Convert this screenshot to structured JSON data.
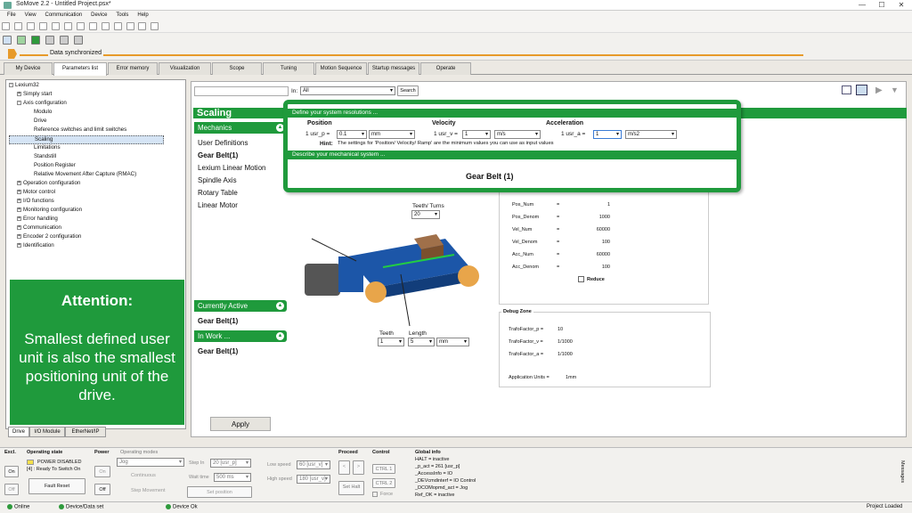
{
  "window": {
    "title": "SoMove 2.2 - Untitled Project.psx*",
    "min": "—",
    "max": "☐",
    "close": "✕"
  },
  "menu": [
    "File",
    "View",
    "Communication",
    "Device",
    "Tools",
    "Help"
  ],
  "sync": {
    "label": "Data synchronized"
  },
  "tabs": [
    "My Device",
    "Parameters list",
    "Error memory",
    "Visualization",
    "Scope",
    "Tuning",
    "Motion Sequence",
    "Startup messages",
    "Operate"
  ],
  "tree": [
    {
      "label": "Lexium32",
      "lvl": 0,
      "exp": "-"
    },
    {
      "label": "Simply start",
      "lvl": 1,
      "exp": "+"
    },
    {
      "label": "Axis configuration",
      "lvl": 1,
      "exp": "-"
    },
    {
      "label": "Modulo",
      "lvl": 2
    },
    {
      "label": "Drive",
      "lvl": 2
    },
    {
      "label": "Reference switches and limit switches",
      "lvl": 2
    },
    {
      "label": "Scaling",
      "lvl": 2,
      "sel": true
    },
    {
      "label": "Limitations",
      "lvl": 2
    },
    {
      "label": "Standstill",
      "lvl": 2
    },
    {
      "label": "Position Register",
      "lvl": 2
    },
    {
      "label": "Relative Movement After Capture (RMAC)",
      "lvl": 2
    },
    {
      "label": "Operation configuration",
      "lvl": 1,
      "exp": "+"
    },
    {
      "label": "Motor control",
      "lvl": 1,
      "exp": "+"
    },
    {
      "label": "I/O functions",
      "lvl": 1,
      "exp": "+"
    },
    {
      "label": "Monitoring configuration",
      "lvl": 1,
      "exp": "+"
    },
    {
      "label": "Error handling",
      "lvl": 1,
      "exp": "+"
    },
    {
      "label": "Communication",
      "lvl": 1,
      "exp": "+"
    },
    {
      "label": "Encoder 2 configuration",
      "lvl": 1,
      "exp": "+"
    },
    {
      "label": "Identification",
      "lvl": 1,
      "exp": "+"
    }
  ],
  "attention": {
    "heading": "Attention:",
    "body": "Smallest defined user unit is also the smallest positioning unit of the drive."
  },
  "bottom_tabs": [
    "Drive",
    "I/O Module",
    "EtherNet/IP"
  ],
  "search": {
    "in_label": "In:",
    "scope": "All",
    "button": "Search"
  },
  "scaling": {
    "title": "Scaling",
    "mechanics_label": "Mechanics",
    "mechanics_items": [
      "User Definitions",
      "Gear Belt(1)",
      "Lexium Linear Motion",
      "Spindle Axis",
      "Rotary Table",
      "Linear Motor"
    ],
    "currently_active_label": "Currently Active",
    "currently_active_value": "Gear Belt(1)",
    "in_work_label": "In Work ...",
    "in_work_value": "Gear Belt(1)",
    "apply": "Apply"
  },
  "callout": {
    "resolutions_title": "Define your system resolutions ...",
    "position_label": "Position",
    "position_unit": "1 usr_p =",
    "position_value": "0.1",
    "position_dim": "mm",
    "velocity_label": "Velocity",
    "velocity_unit": "1 usr_v =",
    "velocity_value": "1",
    "velocity_dim": "m/s",
    "accel_label": "Acceleration",
    "accel_unit": "1 usr_a =",
    "accel_value": "1",
    "accel_dim": "m/s2",
    "hint_label": "Hint:",
    "hint_text": "The settings for 'Position/ Velocity/ Ramp' are the minimum values you can use as input values",
    "mechanical_title": "Describe your mechanical system ...",
    "system_name": "Gear Belt (1)"
  },
  "gearbelt": {
    "teeth_turns_label": "Teeth/ Turns",
    "teeth_turns_value": "20",
    "teeth_label": "Teeth",
    "teeth_value": "1",
    "length_label": "Length",
    "length_value": "5",
    "length_unit": "mm"
  },
  "factors": [
    {
      "name": "Pos_Num",
      "value": "1"
    },
    {
      "name": "Pos_Denom",
      "value": "1000"
    },
    {
      "name": "Vel_Num",
      "value": "60000"
    },
    {
      "name": "Vel_Denom",
      "value": "100"
    },
    {
      "name": "Acc_Num",
      "value": "60000"
    },
    {
      "name": "Acc_Denom",
      "value": "100"
    }
  ],
  "reduce_label": "Reduce",
  "debug": {
    "title": "Debug Zone",
    "rows": [
      {
        "name": "TrafoFactor_p =",
        "value": "10"
      },
      {
        "name": "TrafoFactor_v =",
        "value": "1/1000"
      },
      {
        "name": "TrafoFactor_a =",
        "value": "1/1000"
      }
    ],
    "app_units_label": "Application Units =",
    "app_units_value": "1mm"
  },
  "bottom": {
    "excl": "Excl.",
    "on": "On",
    "off": "Off",
    "opstate_label": "Operating state",
    "opstate_value": "POWER DISABLED",
    "opstate_sub": "[4] : Ready To Switch On",
    "fault_reset": "Fault Reset",
    "power_label": "Power",
    "power_on": "On",
    "power_off": "Off",
    "opmodes_label": "Operating modes",
    "opmode_value": "Jog",
    "continuous": "Continuous",
    "step_movement": "Step Movement",
    "stepin_label": "Step In",
    "stepin_value": "20 [usr_p]",
    "waittime_label": "Wait time",
    "waittime_value": "500 ms",
    "setpos": "Set position",
    "lowspeed_label": "Low speed",
    "lowspeed_value": "60 [usr_v]",
    "highspeed_label": "High speed",
    "highspeed_value": "180 [usr_v]",
    "proceed_label": "Proceed",
    "prev": "<",
    "next": ">",
    "sethalt": "Set Halt",
    "control_label": "Control",
    "ctrl1": "CTRL 1",
    "ctrl2": "CTRL 2",
    "force": "Force",
    "global_label": "Global info",
    "global_lines": [
      "HALT = inactive",
      "_p_act = 261 [usr_p]",
      "_AccessInfo = IO",
      "_DEVcmdinterf = IO Control",
      "_DCOMopmd_act = Jog",
      "Ref_OK = inactive"
    ],
    "messages": "Messages"
  },
  "status": {
    "online": "Online",
    "device": "Device/Data set",
    "device_ok": "Device Ok",
    "project": "Project Loaded"
  }
}
